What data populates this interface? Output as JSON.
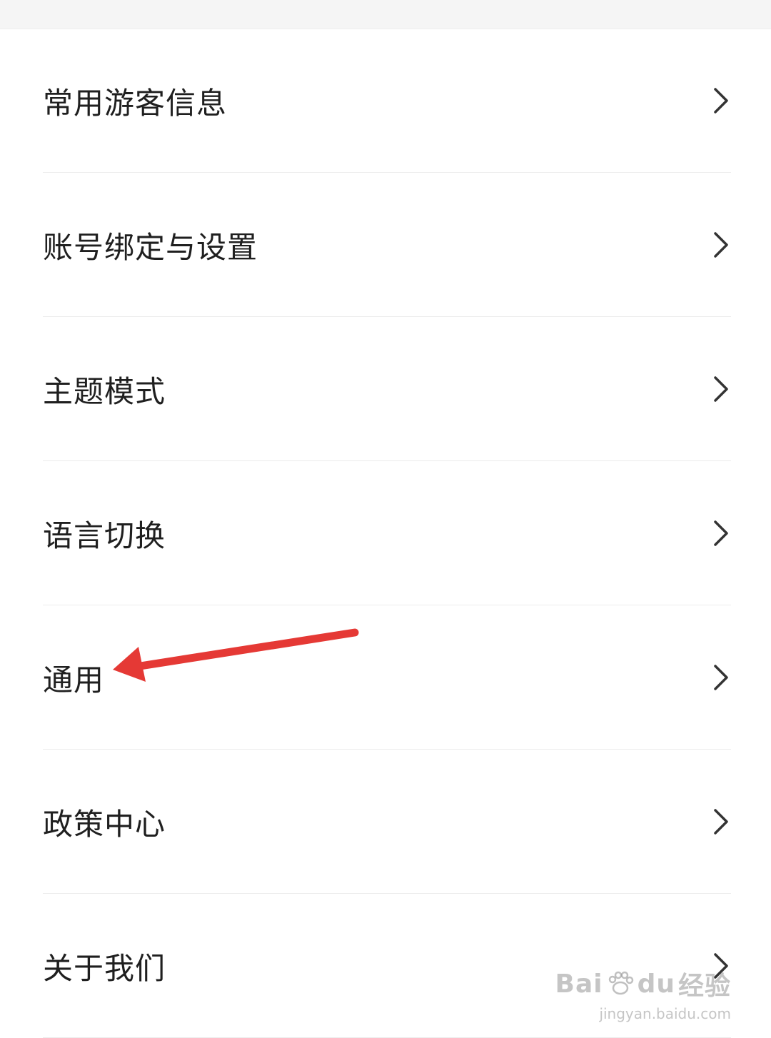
{
  "menu": {
    "items": [
      {
        "label": "常用游客信息",
        "icon": "chevron-right-icon"
      },
      {
        "label": "账号绑定与设置",
        "icon": "chevron-right-icon"
      },
      {
        "label": "主题模式",
        "icon": "chevron-right-icon"
      },
      {
        "label": "语言切换",
        "icon": "chevron-right-icon"
      },
      {
        "label": "通用",
        "icon": "chevron-right-icon"
      },
      {
        "label": "政策中心",
        "icon": "chevron-right-icon"
      },
      {
        "label": "关于我们",
        "icon": "chevron-right-icon"
      }
    ]
  },
  "annotation": {
    "type": "red-arrow",
    "points_to": "通用",
    "color": "#e53935"
  },
  "watermark": {
    "brand": "Bai",
    "brand_suffix": "du",
    "brand_cn": "经验",
    "url": "jingyan.baidu.com"
  },
  "colors": {
    "text": "#1f1f1f",
    "divider": "#ececec",
    "chevron": "#333333",
    "arrow": "#e53935"
  }
}
